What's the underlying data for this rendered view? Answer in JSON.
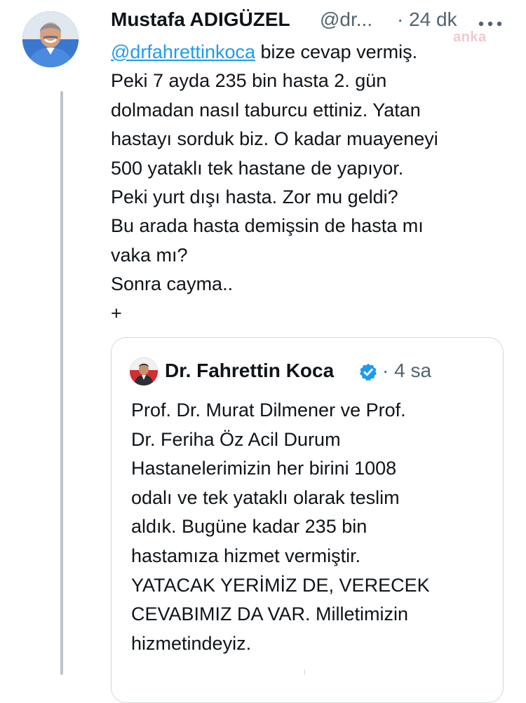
{
  "tweet": {
    "author_name": "Mustafa ADIGÜZEL",
    "author_handle": "@dr...",
    "timestamp": "· 24 dk",
    "more_icon": "ellipsis-icon",
    "watermark": "anka",
    "lines": [
      {
        "mention": "@drfahrettinkoca",
        "text": " bize cevap vermiş."
      },
      {
        "text": "Peki 7 ayda 235 bin hasta 2. gün"
      },
      {
        "text": "dolmadan nasıl taburcu ettiniz. Yatan"
      },
      {
        "text": "hastayı sorduk biz. O kadar muayeneyi"
      },
      {
        "text": "500 yataklı tek hastane de yapıyor."
      },
      {
        "text": "Peki yurt dışı hasta. Zor mu geldi?"
      },
      {
        "text": "Bu arada hasta demişsin de hasta mı"
      },
      {
        "text": "vaka mı?"
      },
      {
        "text": "Sonra cayma.."
      },
      {
        "text": "+"
      }
    ]
  },
  "quote": {
    "author_name": "Dr. Fahrettin Koca",
    "verified_icon": "verified-badge-icon",
    "timestamp": "· 4 sa",
    "lines": [
      "Prof. Dr. Murat Dilmener ve Prof.",
      "Dr. Feriha Öz Acil Durum",
      "Hastanelerimizin her birini 1008",
      "odalı ve tek yataklı olarak teslim",
      "aldık. Bugüne kadar 235 bin",
      "hastamıza hizmet vermiştir.",
      "YATACAK YERİMİZ DE, VERECEK",
      "CEVABIMIZ DA VAR. Milletimizin",
      "hizmetindeyiz."
    ]
  },
  "colors": {
    "text": "#0f1419",
    "secondary": "#536471",
    "link": "#1d9bf0",
    "verified": "#1d9bf0",
    "border": "#cfd9de",
    "thread_line": "#b9c4cc"
  }
}
